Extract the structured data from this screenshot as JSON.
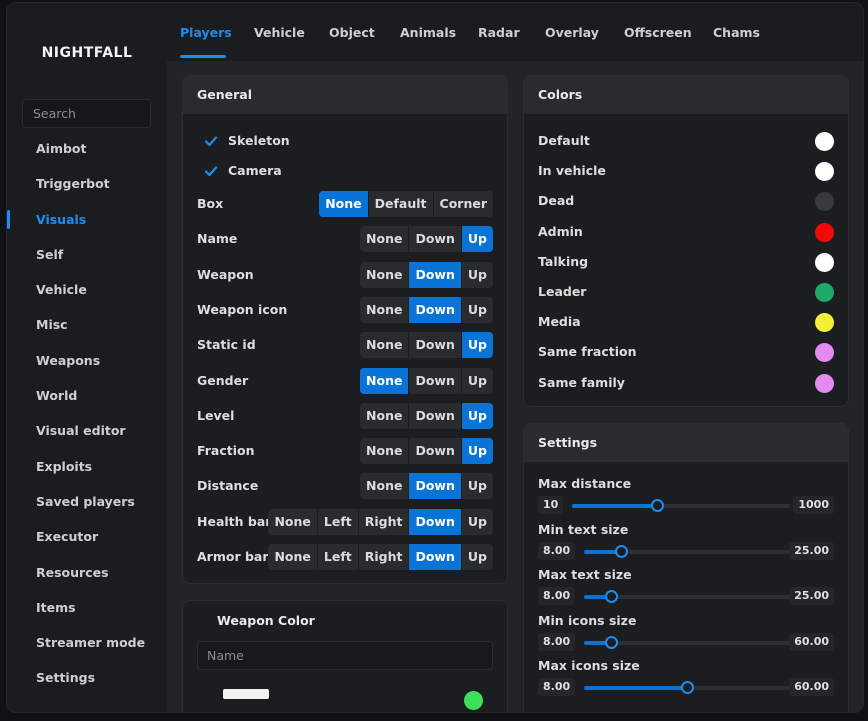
{
  "app": {
    "title": "NIGHTFALL"
  },
  "sidebar": {
    "search_placeholder": "Search",
    "items": [
      {
        "label": "Aimbot"
      },
      {
        "label": "Triggerbot"
      },
      {
        "label": "Visuals",
        "active": true
      },
      {
        "label": "Self"
      },
      {
        "label": "Vehicle"
      },
      {
        "label": "Misc"
      },
      {
        "label": "Weapons"
      },
      {
        "label": "World"
      },
      {
        "label": "Visual editor"
      },
      {
        "label": "Exploits"
      },
      {
        "label": "Saved players"
      },
      {
        "label": "Executor"
      },
      {
        "label": "Resources"
      },
      {
        "label": "Items"
      },
      {
        "label": "Streamer mode"
      },
      {
        "label": "Settings"
      }
    ]
  },
  "tabs": [
    {
      "label": "Players",
      "active": true
    },
    {
      "label": "Vehicle"
    },
    {
      "label": "Object"
    },
    {
      "label": "Animals"
    },
    {
      "label": "Radar"
    },
    {
      "label": "Overlay"
    },
    {
      "label": "Offscreen"
    },
    {
      "label": "Chams"
    }
  ],
  "general": {
    "title": "General",
    "checkboxes": [
      {
        "label": "Skeleton",
        "checked": true
      },
      {
        "label": "Camera",
        "checked": true
      }
    ],
    "options": [
      {
        "label": "Box",
        "choices": [
          "None",
          "Default",
          "Corner"
        ],
        "selected": "None"
      },
      {
        "label": "Name",
        "choices": [
          "None",
          "Down",
          "Up"
        ],
        "selected": "Up"
      },
      {
        "label": "Weapon",
        "choices": [
          "None",
          "Down",
          "Up"
        ],
        "selected": "Down"
      },
      {
        "label": "Weapon icon",
        "choices": [
          "None",
          "Down",
          "Up"
        ],
        "selected": "Down"
      },
      {
        "label": "Static id",
        "choices": [
          "None",
          "Down",
          "Up"
        ],
        "selected": "Up"
      },
      {
        "label": "Gender",
        "choices": [
          "None",
          "Down",
          "Up"
        ],
        "selected": "None"
      },
      {
        "label": "Level",
        "choices": [
          "None",
          "Down",
          "Up"
        ],
        "selected": "Up"
      },
      {
        "label": "Fraction",
        "choices": [
          "None",
          "Down",
          "Up"
        ],
        "selected": "Up"
      },
      {
        "label": "Distance",
        "choices": [
          "None",
          "Down",
          "Up"
        ],
        "selected": "Down"
      },
      {
        "label": "Health bar",
        "choices": [
          "None",
          "Left",
          "Right",
          "Down",
          "Up"
        ],
        "selected": "Down"
      },
      {
        "label": "Armor bar",
        "choices": [
          "None",
          "Left",
          "Right",
          "Down",
          "Up"
        ],
        "selected": "Down"
      }
    ]
  },
  "weapon_color": {
    "title": "Weapon Color",
    "search_placeholder": "Name"
  },
  "colors": {
    "title": "Colors",
    "items": [
      {
        "label": "Default",
        "color": "#ffffff"
      },
      {
        "label": "In vehicle",
        "color": "#ffffff"
      },
      {
        "label": "Dead",
        "color": "#3a3a3c"
      },
      {
        "label": "Admin",
        "color": "#f20a0a"
      },
      {
        "label": "Talking",
        "color": "#ffffff"
      },
      {
        "label": "Leader",
        "color": "#1fa866"
      },
      {
        "label": "Media",
        "color": "#f5f035"
      },
      {
        "label": "Same fraction",
        "color": "#e28af0"
      },
      {
        "label": "Same family",
        "color": "#e28af0"
      }
    ]
  },
  "settings": {
    "title": "Settings",
    "sliders": [
      {
        "label": "Max distance",
        "min": "10",
        "max": "1000",
        "fraction": 0.39
      },
      {
        "label": "Min text size",
        "min": "8.00",
        "max": "25.00",
        "fraction": 0.18
      },
      {
        "label": "Max text size",
        "min": "8.00",
        "max": "25.00",
        "fraction": 0.13
      },
      {
        "label": "Min icons size",
        "min": "8.00",
        "max": "60.00",
        "fraction": 0.13
      },
      {
        "label": "Max icons size",
        "min": "8.00",
        "max": "60.00",
        "fraction": 0.5
      }
    ]
  }
}
